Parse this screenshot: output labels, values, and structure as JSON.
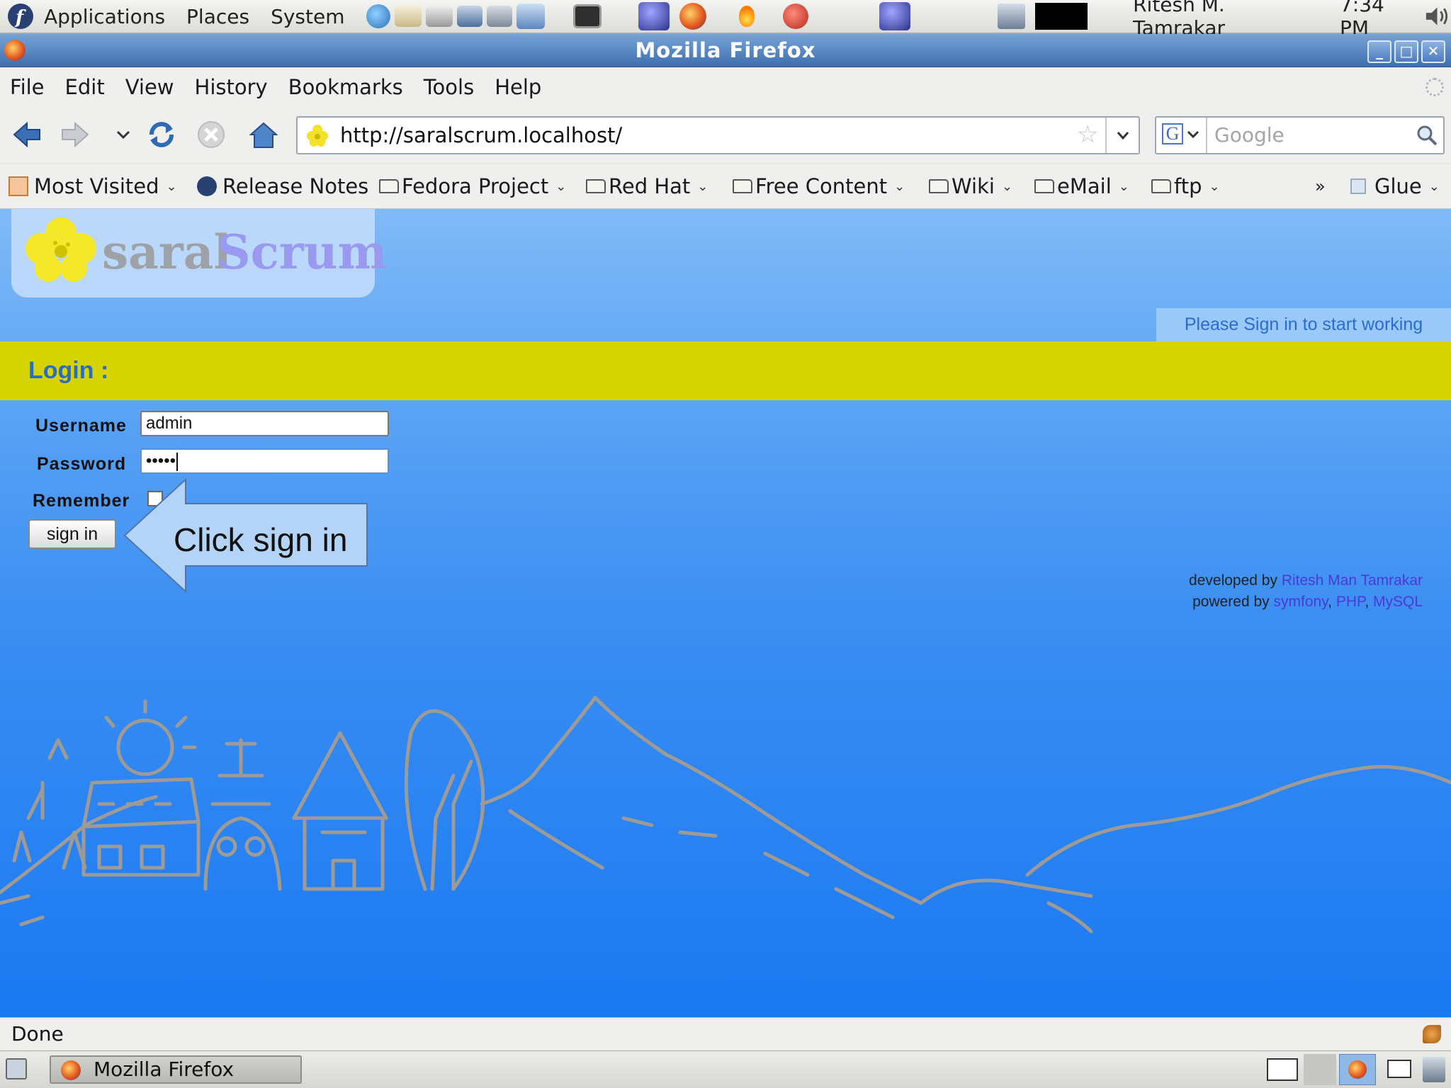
{
  "top_panel": {
    "menus": [
      "Applications",
      "Places",
      "System"
    ],
    "user": "Ritesh M. Tamrakar",
    "clock": "7:34 PM"
  },
  "window": {
    "title": "Mozilla Firefox",
    "controls": [
      "minimize-icon",
      "maximize-icon",
      "close-icon"
    ]
  },
  "menubar": [
    "File",
    "Edit",
    "View",
    "History",
    "Bookmarks",
    "Tools",
    "Help"
  ],
  "navbar": {
    "url": "http://saralscrum.localhost/",
    "search_placeholder": "Google"
  },
  "bookmarks": {
    "most_visited": "Most Visited",
    "release_notes": "Release Notes",
    "fedora": "Fedora Project",
    "redhat": "Red Hat",
    "free_content": "Free Content",
    "wiki": "Wiki",
    "email": "eMail",
    "ftp": "ftp",
    "overflow": "»",
    "glue": "Glue"
  },
  "page": {
    "logo": {
      "word1": "saral",
      "word2": "Scrum"
    },
    "signin_note": "Please Sign in to start working",
    "login_title": "Login :",
    "username_label": "Username",
    "username_value": "admin",
    "password_label": "Password",
    "password_masked": "•••••",
    "remember_label": "Remember",
    "remember_checked": false,
    "submit_label": "sign in",
    "callout": "Click sign in",
    "credits": {
      "developed_by": "developed by",
      "developer": "Ritesh Man Tamrakar",
      "powered_by": "powered by",
      "tech_1": "symfony",
      "tech_2": "PHP",
      "tech_3": "MySQL"
    }
  },
  "status": "Done",
  "taskbar": {
    "task": "Mozilla Firefox"
  },
  "colors": {
    "login_band": "#d6d400",
    "title_blue": "#2b6cc4",
    "link_purple": "#4a3ad8",
    "sky_top": "#80baf7",
    "sky_bottom": "#1a79f1"
  }
}
